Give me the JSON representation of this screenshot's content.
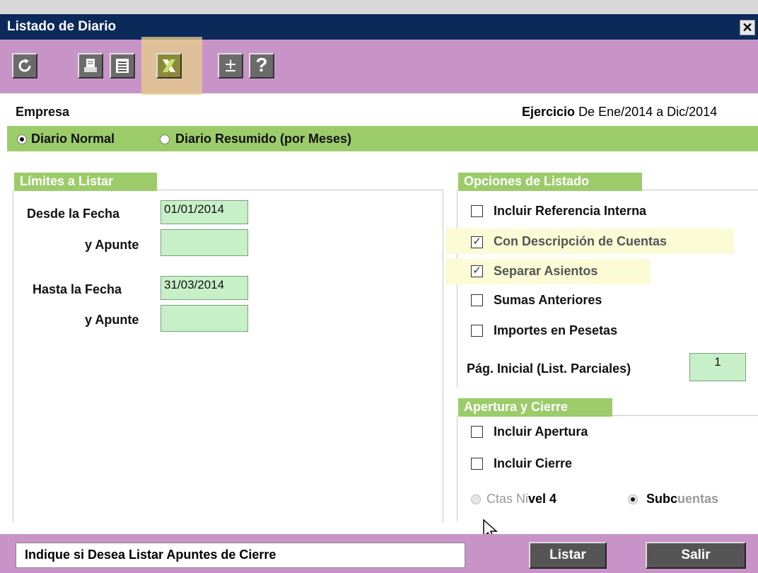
{
  "window": {
    "title": "Listado de Diario",
    "close": "✕"
  },
  "toolbar": {
    "refresh": "refresh-icon",
    "print": "printer-icon",
    "preview": "list-icon",
    "excel": "excel-icon",
    "plusminus": "±",
    "help": "?"
  },
  "header": {
    "empresa_label": "Empresa",
    "ejercicio_label": "Ejercicio",
    "ejercicio_value": "De Ene/2014 a Dic/2014"
  },
  "modes": {
    "normal": "Diario Normal",
    "resumido": "Diario Resumido (por Meses)",
    "selected": "normal"
  },
  "limits": {
    "heading": "Límites a Listar",
    "desde_fecha_label": "Desde la Fecha",
    "desde_fecha": "01/01/2014",
    "apunte1_label": "y Apunte",
    "apunte1": "",
    "hasta_fecha_label": "Hasta la Fecha",
    "hasta_fecha": "31/03/2014",
    "apunte2_label": "y Apunte",
    "apunte2": ""
  },
  "options": {
    "heading": "Opciones de Listado",
    "items": [
      {
        "label": "Incluir Referencia Interna",
        "checked": false
      },
      {
        "label": "Con Descripción de Cuentas",
        "checked": true
      },
      {
        "label": "Separar Asientos",
        "checked": true
      },
      {
        "label": "Sumas Anteriores",
        "checked": false
      },
      {
        "label": "Importes en Pesetas",
        "checked": false
      }
    ],
    "pag_label": "Pág. Inicial (List. Parciales)",
    "pag_value": "1"
  },
  "apertura": {
    "heading": "Apertura y Cierre",
    "incluir_apertura": "Incluir Apertura",
    "incluir_cierre": "Incluir Cierre",
    "ctas_pre": "Ctas Ni",
    "ctas_bold": "vel 4",
    "sub_bold": "Subc",
    "sub_rest": "uentas"
  },
  "footer": {
    "status": "Indique si Desea Listar Apuntes de Cierre",
    "listar": "Listar",
    "salir": "Salir"
  }
}
